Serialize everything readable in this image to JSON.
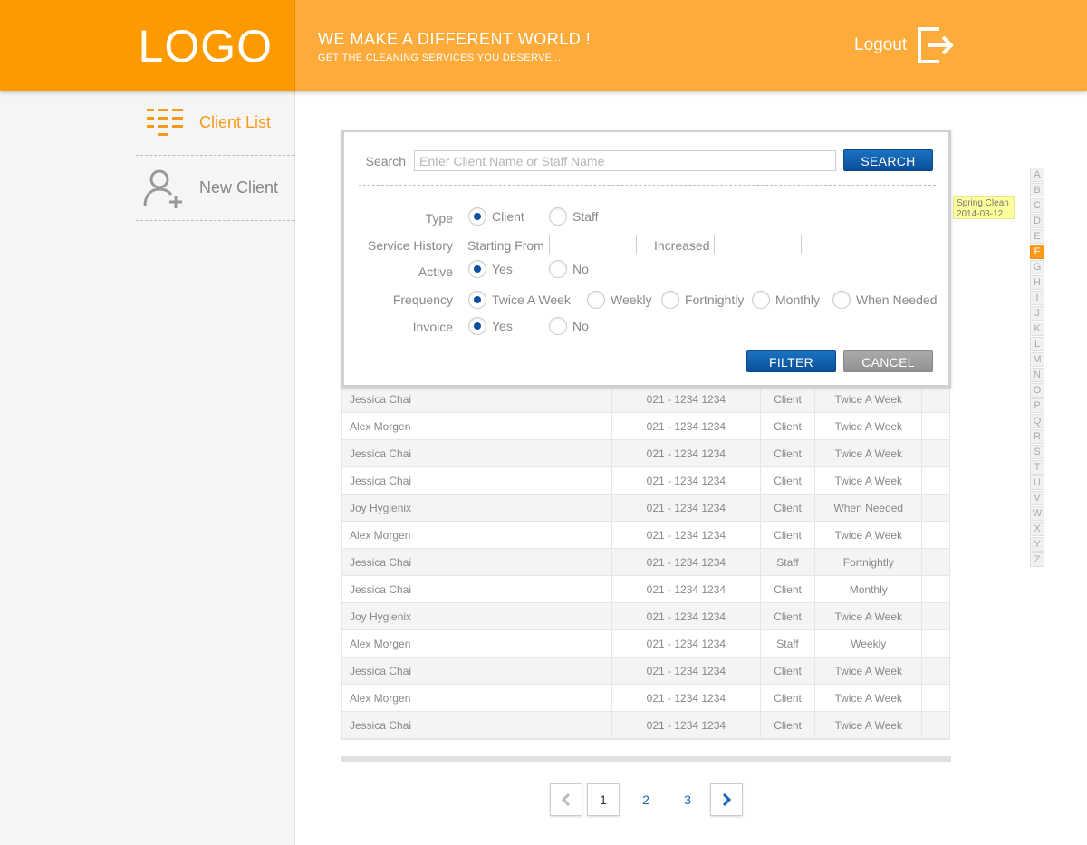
{
  "header": {
    "logo": "LOGO",
    "tagline_main": "WE MAKE A DIFFERENT WORLD !",
    "tagline_sub": "GET THE CLEANING SERVICES YOU DESERVE...",
    "logout_label": "Logout",
    "colors": {
      "logo_bg": "#fd9a00",
      "header_bg": "#fdab3a"
    }
  },
  "sidebar": {
    "items": [
      {
        "label": "Client List",
        "icon": "list-icon",
        "active": true
      },
      {
        "label": "New Client",
        "icon": "add-user-icon",
        "active": false
      }
    ]
  },
  "filter": {
    "search_label": "Search",
    "search_placeholder": "Enter Client Name or Staff Name",
    "search_button": "SEARCH",
    "type_label": "Type",
    "type_options": [
      "Client",
      "Staff"
    ],
    "type_selected": "Client",
    "service_history_label": "Service History",
    "starting_from_label": "Starting From",
    "increased_label": "Increased",
    "active_label": "Active",
    "active_options": [
      "Yes",
      "No"
    ],
    "active_selected": "Yes",
    "frequency_label": "Frequency",
    "frequency_options": [
      "Twice A Week",
      "Weekly",
      "Fortnightly",
      "Monthly",
      "When Needed"
    ],
    "frequency_selected": "Twice A Week",
    "invoice_label": "Invoice",
    "invoice_options": [
      "Yes",
      "No"
    ],
    "invoice_selected": "Yes",
    "filter_button": "FILTER",
    "cancel_button": "CANCEL"
  },
  "table": {
    "rows": [
      {
        "name": "Jessica Chai",
        "phone": "021 - 1234 1234",
        "type": "Client",
        "frequency": "Twice A Week"
      },
      {
        "name": "Alex Morgen",
        "phone": "021 - 1234 1234",
        "type": "Client",
        "frequency": "Twice A Week"
      },
      {
        "name": "Jessica Chai",
        "phone": "021 - 1234 1234",
        "type": "Client",
        "frequency": "Twice A Week"
      },
      {
        "name": "Jessica Chai",
        "phone": "021 - 1234 1234",
        "type": "Client",
        "frequency": "Twice A Week"
      },
      {
        "name": "Joy Hygienix",
        "phone": "021 - 1234 1234",
        "type": "Client",
        "frequency": "When Needed"
      },
      {
        "name": "Alex Morgen",
        "phone": "021 - 1234 1234",
        "type": "Client",
        "frequency": "Twice A Week"
      },
      {
        "name": "Jessica Chai",
        "phone": "021 - 1234 1234",
        "type": "Staff",
        "frequency": "Fortnightly"
      },
      {
        "name": "Jessica Chai",
        "phone": "021 - 1234 1234",
        "type": "Client",
        "frequency": "Monthly"
      },
      {
        "name": "Joy Hygienix",
        "phone": "021 - 1234 1234",
        "type": "Client",
        "frequency": "Twice A Week"
      },
      {
        "name": "Alex Morgen",
        "phone": "021 - 1234 1234",
        "type": "Staff",
        "frequency": "Weekly"
      },
      {
        "name": "Jessica Chai",
        "phone": "021 - 1234 1234",
        "type": "Client",
        "frequency": "Twice A Week"
      },
      {
        "name": "Alex Morgen",
        "phone": "021 - 1234 1234",
        "type": "Client",
        "frequency": "Twice A Week"
      },
      {
        "name": "Jessica Chai",
        "phone": "021 - 1234 1234",
        "type": "Client",
        "frequency": "Twice A Week"
      }
    ]
  },
  "tooltip": {
    "line1": "Spring Clean",
    "line2": "2014-03-12"
  },
  "alphabet": {
    "letters": [
      "A",
      "B",
      "C",
      "D",
      "E",
      "F",
      "G",
      "H",
      "I",
      "J",
      "K",
      "L",
      "M",
      "N",
      "O",
      "P",
      "Q",
      "R",
      "S",
      "T",
      "U",
      "V",
      "W",
      "X",
      "Y",
      "Z"
    ],
    "active": "F"
  },
  "pagination": {
    "pages": [
      "1",
      "2",
      "3"
    ],
    "current": "1"
  }
}
